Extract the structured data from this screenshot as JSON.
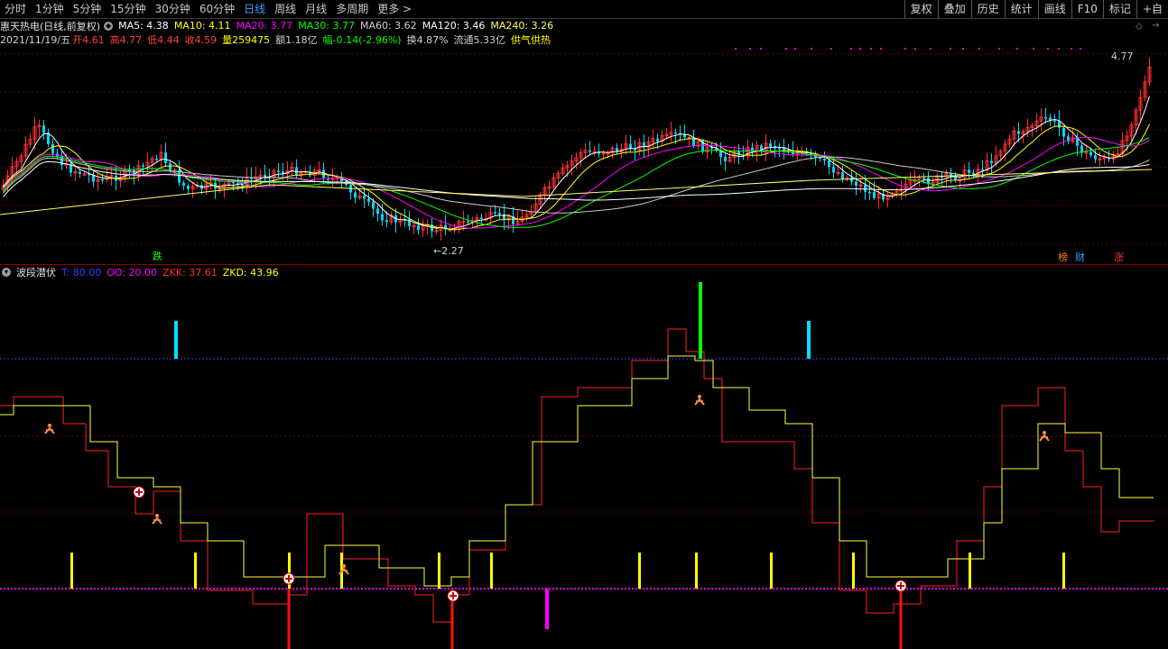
{
  "tabs": [
    {
      "label": "分时",
      "active": false
    },
    {
      "label": "1分钟",
      "active": false
    },
    {
      "label": "5分钟",
      "active": false
    },
    {
      "label": "15分钟",
      "active": false
    },
    {
      "label": "30分钟",
      "active": false
    },
    {
      "label": "60分钟",
      "active": false
    },
    {
      "label": "日线",
      "active": true
    },
    {
      "label": "周线",
      "active": false
    },
    {
      "label": "月线",
      "active": false
    },
    {
      "label": "多周期",
      "active": false
    },
    {
      "label": "更多 >",
      "active": false
    }
  ],
  "right_tools": [
    "复权",
    "叠加",
    "历史",
    "统计",
    "画线",
    "F10",
    "标记",
    "+自"
  ],
  "stock": {
    "title": "惠天热电(日线,前复权)",
    "ma": [
      {
        "label": "MA5: 4.38",
        "color": "#ffffff"
      },
      {
        "label": "MA10: 4.11",
        "color": "#ffff00"
      },
      {
        "label": "MA20: 3.77",
        "color": "#ff00ff"
      },
      {
        "label": "MA30: 3.77",
        "color": "#00ff00"
      },
      {
        "label": "MA60: 3.62",
        "color": "#d0d0d0"
      },
      {
        "label": "MA120: 3.46",
        "color": "#ffffff"
      },
      {
        "label": "MA240: 3.26",
        "color": "#ffff66"
      }
    ],
    "date": "2021/11/19/五",
    "quote": [
      {
        "label": "开4.61",
        "color": "#ff4040"
      },
      {
        "label": "高4.77",
        "color": "#ff4040"
      },
      {
        "label": "低4.44",
        "color": "#ff4040"
      },
      {
        "label": "收4.59",
        "color": "#ff4040"
      },
      {
        "label": "量259475",
        "color": "#ffff00"
      },
      {
        "label": "额1.18亿",
        "color": "#d0d0d0"
      },
      {
        "label": "幅-0.14(-2.96%)",
        "color": "#00ff00"
      },
      {
        "label": "换4.87%",
        "color": "#d0d0d0"
      },
      {
        "label": "流通5.33亿",
        "color": "#d0d0d0"
      },
      {
        "label": "供气供热",
        "color": "#ffff00"
      }
    ],
    "price_high": "4.77",
    "price_low": "←2.27",
    "marker_left": "跌",
    "marker_right": [
      "榜",
      "财",
      "涨"
    ]
  },
  "indicator": {
    "name": "波段潜伏",
    "params": [
      {
        "label": "T: 80.00",
        "color": "#3a3aff"
      },
      {
        "label": "OO: 20.00",
        "color": "#ff00ff"
      },
      {
        "label": "ZKK: 37.61",
        "color": "#ff3030"
      },
      {
        "label": "ZKD: 43.96",
        "color": "#ffff00"
      }
    ]
  },
  "colors": {
    "up": "#ff3030",
    "down": "#00d8ff",
    "grid": "#7a0000",
    "active_tab": "#3aa0ff"
  }
}
